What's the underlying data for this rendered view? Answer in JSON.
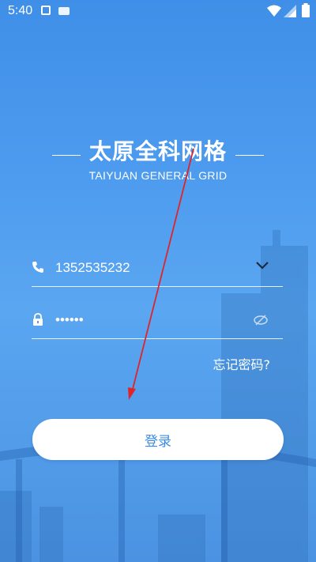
{
  "status_bar": {
    "time": "5:40"
  },
  "app": {
    "title": "太原全科网格",
    "subtitle": "TAIYUAN GENERAL GRID"
  },
  "login_form": {
    "phone_value": "1352535232",
    "password_value": "••••••",
    "forgot_label": "忘记密码?",
    "login_label": "登录"
  },
  "colors": {
    "background": "#4d9bef",
    "button_text": "#3b8be6",
    "annotation": "#e0242a"
  }
}
